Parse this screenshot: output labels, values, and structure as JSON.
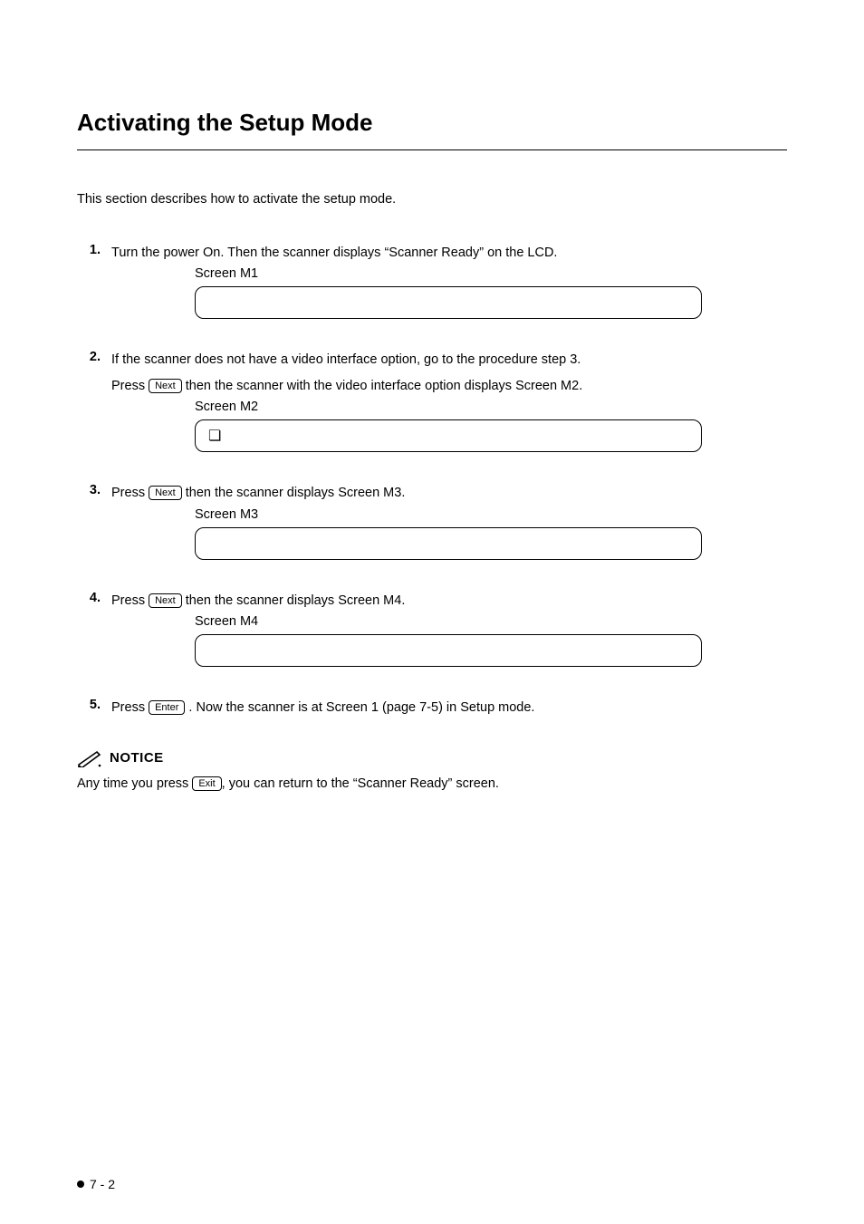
{
  "title": "Activating the Setup Mode",
  "intro": "This section describes how to activate the setup mode.",
  "steps": [
    {
      "num": "1.",
      "text_before": "Turn the power On. Then the scanner displays “Scanner Ready” on the LCD.",
      "screen_label": "Screen M1",
      "screen_icon": ""
    },
    {
      "num": "2.",
      "text_before": "If the scanner does not have a video interface option, go to the procedure step 3.",
      "sub_text_pre": "Press ",
      "sub_key": "Next",
      "sub_text_post": " then the scanner with the video interface option displays Screen M2.",
      "screen_label": "Screen M2",
      "screen_icon": "❏"
    },
    {
      "num": "3.",
      "pre": "Press ",
      "key": "Next",
      "post": " then the scanner displays Screen M3.",
      "screen_label": "Screen M3",
      "screen_icon": ""
    },
    {
      "num": "4.",
      "pre": "Press ",
      "key": "Next",
      "post": " then the scanner displays Screen M4.",
      "screen_label": "Screen M4",
      "screen_icon": ""
    },
    {
      "num": "5.",
      "pre": "Press ",
      "key": "Enter",
      "post": " . Now the scanner is at Screen 1 (page 7-5) in Setup mode."
    }
  ],
  "notice": {
    "label": "NOTICE",
    "text_pre": "Any time you press ",
    "key": "Exit",
    "text_post": ", you can return to the “Scanner Ready” screen."
  },
  "footer": "7 - 2"
}
